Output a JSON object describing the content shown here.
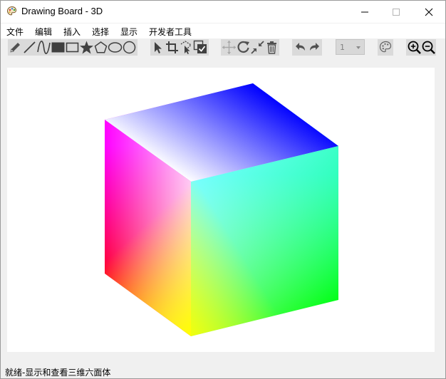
{
  "window": {
    "title": "Drawing Board - 3D",
    "icon": "palette-icon"
  },
  "menu": [
    "文件",
    "编辑",
    "插入",
    "选择",
    "显示",
    "开发者工具"
  ],
  "toolbar": {
    "draw_tools": [
      "pencil-icon",
      "line-icon",
      "curve-icon",
      "filled-rectangle-icon",
      "rectangle-icon",
      "star-icon",
      "pentagon-icon",
      "ellipse-icon",
      "circle-icon"
    ],
    "edit_tools": [
      "select-arrow-icon",
      "crop-icon",
      "lasso-select-icon",
      "checkbox-icon",
      "move-icon",
      "rotate-icon",
      "shrink-icon",
      "trash-icon"
    ],
    "history_tools": [
      "undo-icon",
      "redo-icon"
    ],
    "line_width_value": "1",
    "view_tools": [
      "palette-icon",
      "zoom-in-icon",
      "zoom-out-icon"
    ]
  },
  "canvas": {
    "object": "rgb-cube",
    "colors": {
      "top_far": "#0000ff",
      "top_left": "#ff00ff",
      "top_right": "#00ffff",
      "front_center": "#ffffff",
      "bottom_left": "#ff0000",
      "bottom_front": "#ffff00",
      "bottom_right": "#00ff00"
    }
  },
  "status": {
    "text": "就绪-显示和查看三维六面体"
  }
}
